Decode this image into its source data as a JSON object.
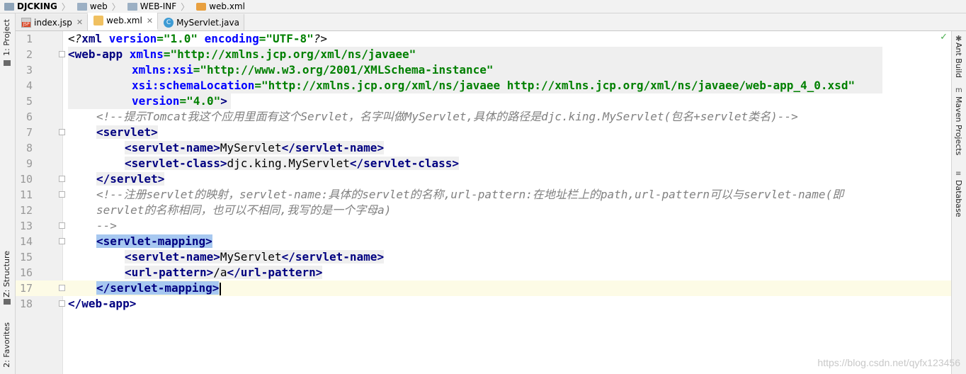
{
  "breadcrumb": [
    {
      "label": "DJCKING",
      "icon": "project-icon"
    },
    {
      "label": "web",
      "icon": "folder-icon"
    },
    {
      "label": "WEB-INF",
      "icon": "folder-icon"
    },
    {
      "label": "web.xml",
      "icon": "xml-file-icon"
    }
  ],
  "tabs": [
    {
      "label": "index.jsp",
      "icon": "jsp-file-icon",
      "active": false
    },
    {
      "label": "web.xml",
      "icon": "xml-file-icon",
      "active": true
    },
    {
      "label": "MyServlet.java",
      "icon": "java-class-icon",
      "active": false
    }
  ],
  "left_tools": {
    "project": "1: Project",
    "structure": "Z: Structure",
    "favorites": "2: Favorites"
  },
  "right_tools": {
    "ant": "Ant Build",
    "maven": "Maven Projects",
    "database": "Database"
  },
  "editor": {
    "line_numbers": [
      "1",
      "2",
      "3",
      "4",
      "5",
      "6",
      "7",
      "8",
      "9",
      "10",
      "11",
      "12",
      "13",
      "14",
      "15",
      "16",
      "17",
      "18"
    ],
    "code": {
      "l1_a": "<?",
      "l1_b": "xml",
      "l1_c": " version",
      "l1_d": "=\"1.0\"",
      "l1_e": " encoding",
      "l1_f": "=\"UTF-8\"",
      "l1_g": "?>",
      "l2_a": "<",
      "l2_b": "web-app",
      "l2_c": " xmlns",
      "l2_d": "=\"http://xmlns.jcp.org/xml/ns/javaee\"",
      "l3_a": "xmlns:xsi",
      "l3_b": "=\"http://www.w3.org/2001/XMLSchema-instance\"",
      "l4_a": "xsi:schemaLocation",
      "l4_b": "=\"http://xmlns.jcp.org/xml/ns/javaee http://xmlns.jcp.org/xml/ns/javaee/web-app_4_0.xsd\"",
      "l5_a": "version",
      "l5_b": "=\"4.0\"",
      "l5_c": ">",
      "l6": "<!--提示Tomcat我这个应用里面有这个Servlet，名字叫做MyServlet,具体的路径是djc.king.MyServlet(包名+servlet类名)-->",
      "l7_tag": "servlet",
      "l8_tag": "servlet-name",
      "l8_text": "MyServlet",
      "l9_tag": "servlet-class",
      "l9_text": "djc.king.MyServlet",
      "l10_tag": "servlet",
      "l11": "<!--注册servlet的映射，servlet-name:具体的servlet的名称,url-pattern:在地址栏上的path,url-pattern可以与servlet-name(即",
      "l12": "servlet的名称相同，也可以不相同,我写的是一个字母a)",
      "l13": "-->",
      "l14_tag": "servlet-mapping",
      "l15_tag": "servlet-name",
      "l15_text": "MyServlet",
      "l16_tag": "url-pattern",
      "l16_text": "/a",
      "l17_tag": "servlet-mapping",
      "l18_tag": "web-app"
    }
  },
  "watermark": "https://blog.csdn.net/qyfx123456",
  "colors": {
    "tag": "#000080",
    "attr": "#0000ff",
    "value": "#008000",
    "comment": "#808080",
    "selection": "#a7c8f0",
    "caret_line": "#fdfbe6"
  }
}
